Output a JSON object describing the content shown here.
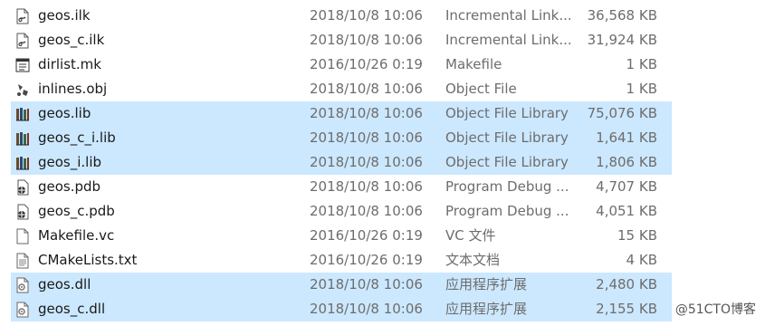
{
  "files": [
    {
      "name": "geos.ilk",
      "date": "2018/10/8 10:06",
      "type": "Incremental Link...",
      "size": "36,568 KB",
      "icon": "ilk-file-icon",
      "selected": false
    },
    {
      "name": "geos_c.ilk",
      "date": "2018/10/8 10:06",
      "type": "Incremental Link...",
      "size": "31,924 KB",
      "icon": "ilk-file-icon",
      "selected": false
    },
    {
      "name": "dirlist.mk",
      "date": "2016/10/26 0:19",
      "type": "Makefile",
      "size": "1 KB",
      "icon": "makefile-icon",
      "selected": false
    },
    {
      "name": "inlines.obj",
      "date": "2018/10/8 10:06",
      "type": "Object File",
      "size": "1 KB",
      "icon": "object-file-icon",
      "selected": false
    },
    {
      "name": "geos.lib",
      "date": "2018/10/8 10:06",
      "type": "Object File Library",
      "size": "75,076 KB",
      "icon": "library-icon",
      "selected": true
    },
    {
      "name": "geos_c_i.lib",
      "date": "2018/10/8 10:06",
      "type": "Object File Library",
      "size": "1,641 KB",
      "icon": "library-icon",
      "selected": true
    },
    {
      "name": "geos_i.lib",
      "date": "2018/10/8 10:06",
      "type": "Object File Library",
      "size": "1,806 KB",
      "icon": "library-icon",
      "selected": true
    },
    {
      "name": "geos.pdb",
      "date": "2018/10/8 10:06",
      "type": "Program Debug ...",
      "size": "4,707 KB",
      "icon": "pdb-file-icon",
      "selected": false
    },
    {
      "name": "geos_c.pdb",
      "date": "2018/10/8 10:06",
      "type": "Program Debug ...",
      "size": "4,051 KB",
      "icon": "pdb-file-icon",
      "selected": false
    },
    {
      "name": "Makefile.vc",
      "date": "2016/10/26 0:19",
      "type": "VC 文件",
      "size": "15 KB",
      "icon": "blank-file-icon",
      "selected": false
    },
    {
      "name": "CMakeLists.txt",
      "date": "2016/10/26 0:19",
      "type": "文本文档",
      "size": "4 KB",
      "icon": "text-file-icon",
      "selected": false
    },
    {
      "name": "geos.dll",
      "date": "2018/10/8 10:06",
      "type": "应用程序扩展",
      "size": "2,480 KB",
      "icon": "dll-file-icon",
      "selected": true
    },
    {
      "name": "geos_c.dll",
      "date": "2018/10/8 10:06",
      "type": "应用程序扩展",
      "size": "2,155 KB",
      "icon": "dll-file-icon",
      "selected": true
    }
  ],
  "watermark": "@51CTO博客",
  "colors": {
    "selection": "#cce8ff",
    "secondary_text": "#6d6d6d"
  }
}
